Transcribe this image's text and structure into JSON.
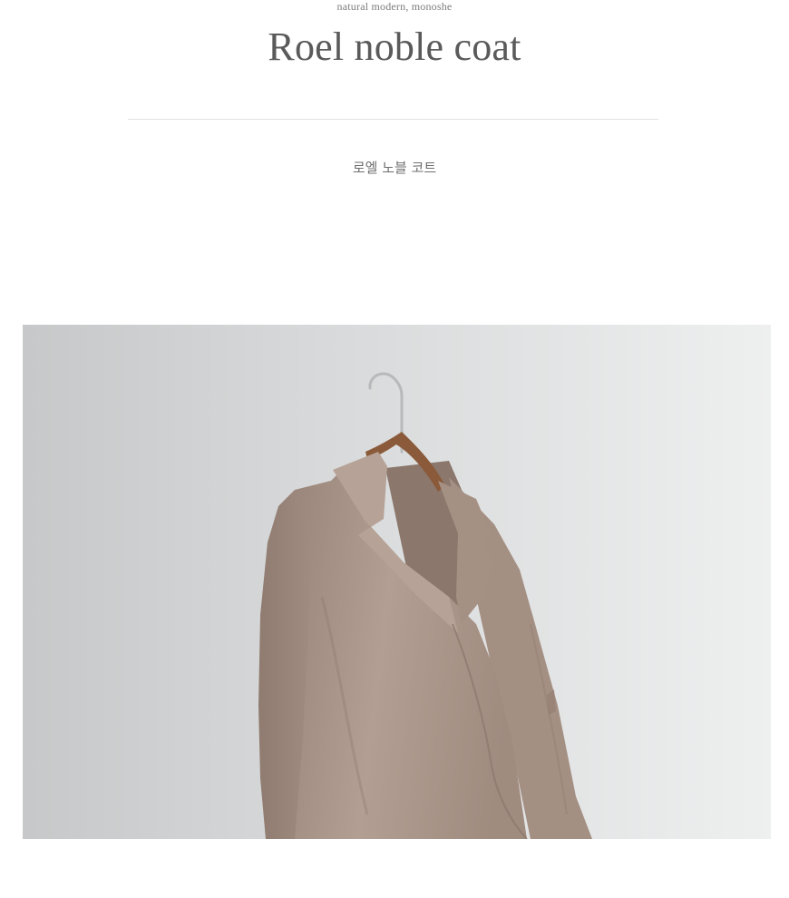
{
  "header": {
    "tagline": "natural modern, monoshe",
    "title": "Roel noble coat",
    "subtitle": "로엘 노블 코트"
  },
  "product_image": {
    "subject": "beige coat on wooden hanger",
    "colors": {
      "coat": "#a99386",
      "hanger_wood": "#8a5a3a",
      "background": "#dcdedf"
    }
  }
}
